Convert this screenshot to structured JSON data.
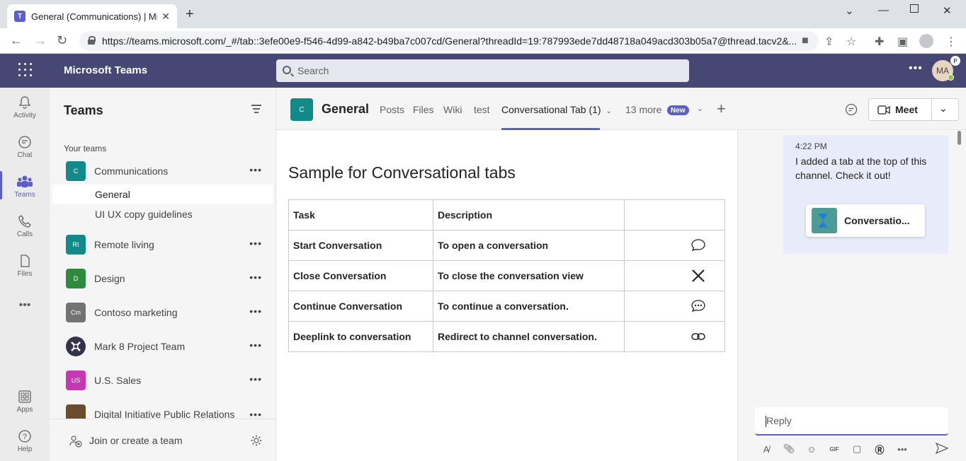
{
  "browser": {
    "tab_title": "General (Communications) | Micr",
    "url": "https://teams.microsoft.com/_#/tab::3efe00e9-f546-4d99-a842-b49ba7c007cd/General?threadId=19:787993ede7dd48718a049acd303b05a7@thread.tacv2&..."
  },
  "header": {
    "app_name": "Microsoft Teams",
    "search_placeholder": "Search",
    "avatar_initials": "MA",
    "avatar_badge": "P"
  },
  "rail": {
    "items": [
      {
        "label": "Activity",
        "icon": "bell-icon"
      },
      {
        "label": "Chat",
        "icon": "chat-icon"
      },
      {
        "label": "Teams",
        "icon": "teams-icon"
      },
      {
        "label": "Calls",
        "icon": "phone-icon"
      },
      {
        "label": "Files",
        "icon": "file-icon"
      },
      {
        "label": "Apps",
        "icon": "apps-icon"
      },
      {
        "label": "Help",
        "icon": "help-icon"
      }
    ]
  },
  "teams_list": {
    "title": "Teams",
    "section_label": "Your teams",
    "teams": [
      {
        "name": "Communications",
        "initials": "C",
        "color": "#138a8a"
      },
      {
        "name": "Remote living",
        "initials": "RI",
        "color": "#138a8a"
      },
      {
        "name": "Design",
        "initials": "D",
        "color": "#2e8b3e"
      },
      {
        "name": "Contoso marketing",
        "initials": "Cm",
        "color": "#737373"
      },
      {
        "name": "Mark 8 Project Team",
        "initials": "",
        "color": "#33344a"
      },
      {
        "name": "U.S. Sales",
        "initials": "US",
        "color": "#c239b3"
      },
      {
        "name": "Digital Initiative Public Relations",
        "initials": "",
        "color": "#6b4c2e"
      }
    ],
    "channels": [
      "General",
      "UI UX copy guidelines"
    ],
    "join_label": "Join or create a team"
  },
  "channel_header": {
    "avatar_initials": "C",
    "channel_name": "General",
    "tabs": [
      "Posts",
      "Files",
      "Wiki",
      "test",
      "Conversational Tab (1)"
    ],
    "more_label": "13 more",
    "new_badge": "New",
    "meet_label": "Meet"
  },
  "tab_content": {
    "title": "Sample for Conversational tabs",
    "columns": [
      "Task",
      "Description",
      ""
    ],
    "rows": [
      {
        "task": "Start Conversation",
        "description": "To open a conversation",
        "icon": "chat-bubble-icon"
      },
      {
        "task": "Close Conversation",
        "description": "To close the conversation view",
        "icon": "close-icon"
      },
      {
        "task": "Continue Conversation",
        "description": "To continue a conversation.",
        "icon": "chat-dots-icon"
      },
      {
        "task": "Deeplink to conversation",
        "description": "Redirect to channel conversation.",
        "icon": "link-icon"
      }
    ]
  },
  "conversation": {
    "time": "4:22 PM",
    "message": "I added a tab at the top of this channel. Check it out!",
    "card_label": "Conversatio...",
    "reply_placeholder": "Reply"
  }
}
